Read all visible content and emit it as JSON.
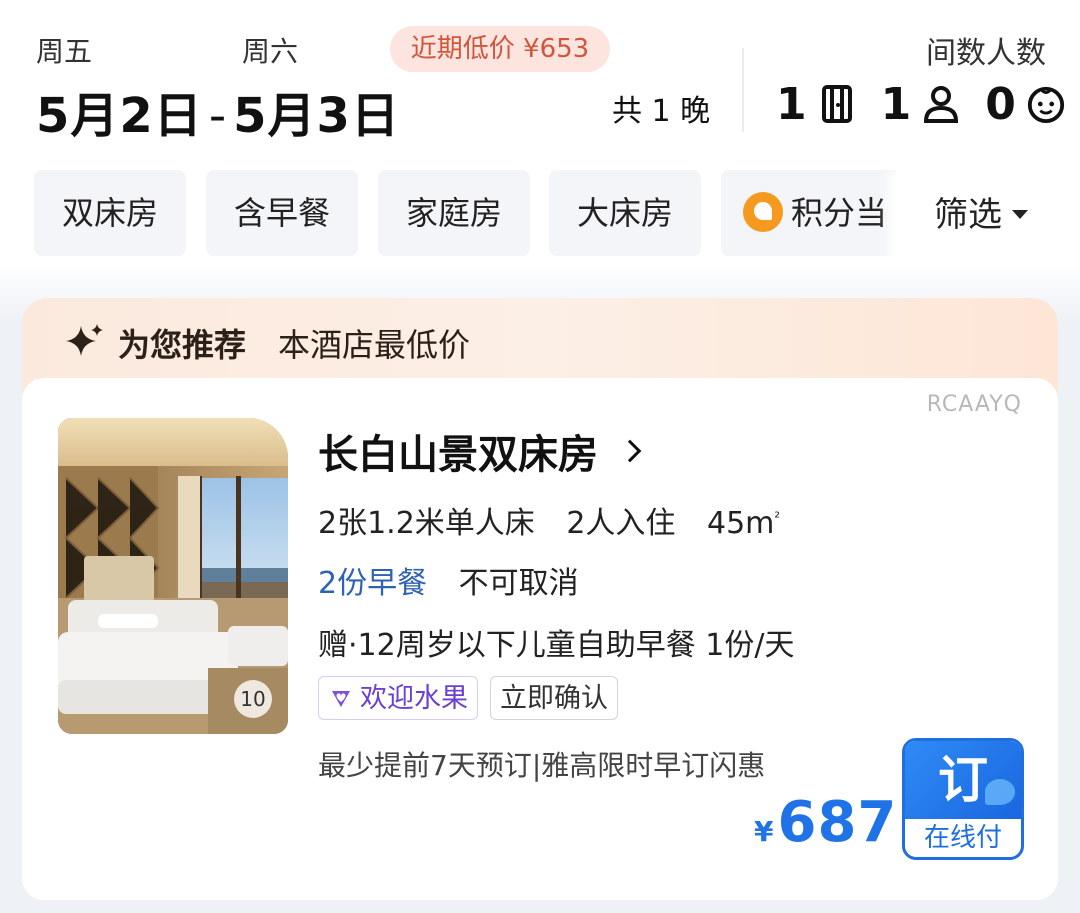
{
  "header": {
    "checkin_weekday": "周五",
    "checkout_weekday": "周六",
    "recent_low_price": "近期低价 ¥653",
    "checkin_date": "5月2日",
    "date_separator": "-",
    "checkout_date": "5月3日",
    "nights": "共 1 晚",
    "guests_label": "间数人数",
    "rooms": "1",
    "adults": "1",
    "children": "0"
  },
  "filters": {
    "chips": [
      "双床房",
      "含早餐",
      "家庭房",
      "大床房",
      "积分当"
    ],
    "filter_button": "筛选"
  },
  "recommend": {
    "title": "为您推荐",
    "subtitle": "本酒店最低价"
  },
  "room": {
    "code": "RCAAYQ",
    "photo_count": "10",
    "name": "长白山景双床房",
    "bed": "2张1.2米单人床",
    "occupancy": "2人入住",
    "area": "45m",
    "area_sup": "²",
    "breakfast": "2份早餐",
    "cancel_policy": "不可取消",
    "gift": "赠·12周岁以下儿童自助早餐 1份/天",
    "tags": [
      "欢迎水果",
      "立即确认"
    ],
    "promo": "最少提前7天预订|雅高限时早订闪惠",
    "currency": "¥",
    "price": "687",
    "book_label": "订",
    "pay_label": "在线付"
  },
  "colors": {
    "accent_blue": "#1f73e6",
    "breakfast_blue": "#2e62b5",
    "low_price_text": "#d0573c",
    "low_price_bg": "#fde4de",
    "tag_purple": "#6a3fd4"
  },
  "icons": {
    "room_icon": "door-icon",
    "adult_icon": "person-icon",
    "child_icon": "child-face-icon",
    "points_icon": "points-coin-icon",
    "recommend_icon": "sparkle-icon",
    "tag_icon": "heart-diamond-icon"
  }
}
